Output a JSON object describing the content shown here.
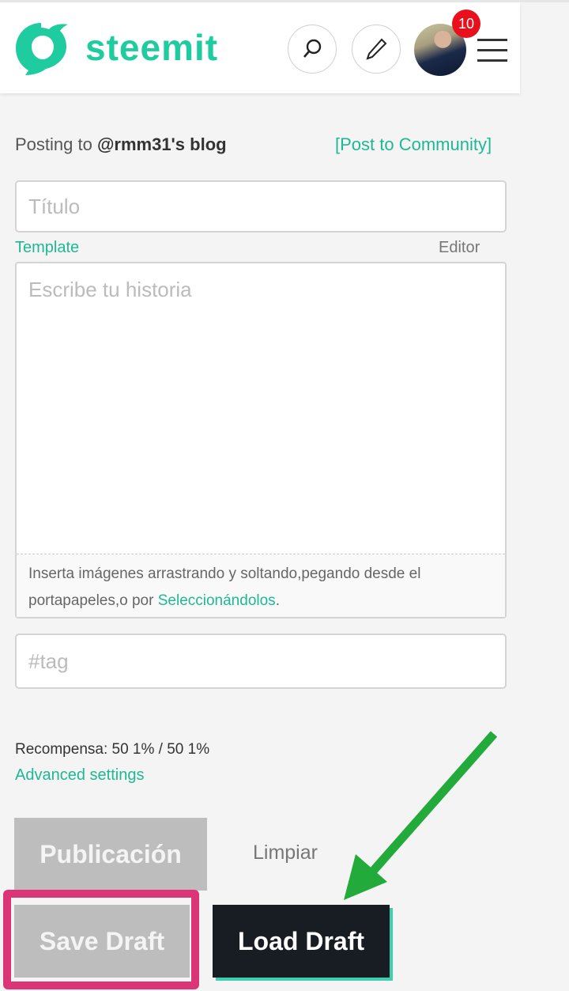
{
  "header": {
    "brand": "steemit",
    "notification_count": "10",
    "colors": {
      "brand": "#1fcca0",
      "badge": "#e8101c"
    }
  },
  "form": {
    "posting_prefix": "Posting to ",
    "posting_target": "@rmm31's blog",
    "post_to_community": "[Post to Community]",
    "title_placeholder": "Título",
    "template_link": "Template",
    "editor_link": "Editor",
    "body_placeholder": "Escribe tu historia",
    "upload_hint": "Inserta imágenes arrastrando y soltando,pegando desde el portapapeles,o por ",
    "upload_link": "Seleccionándolos",
    "upload_end": ".",
    "tag_placeholder": "#tag",
    "reward": "Recompensa: 50 1% / 50 1%",
    "advanced": "Advanced settings"
  },
  "buttons": {
    "publish": "Publicación",
    "clear": "Limpiar",
    "save_draft": "Save Draft",
    "load_draft": "Load Draft"
  },
  "annotations": {
    "highlight_color": "#dc3577",
    "arrow_color": "#22aa3a"
  }
}
